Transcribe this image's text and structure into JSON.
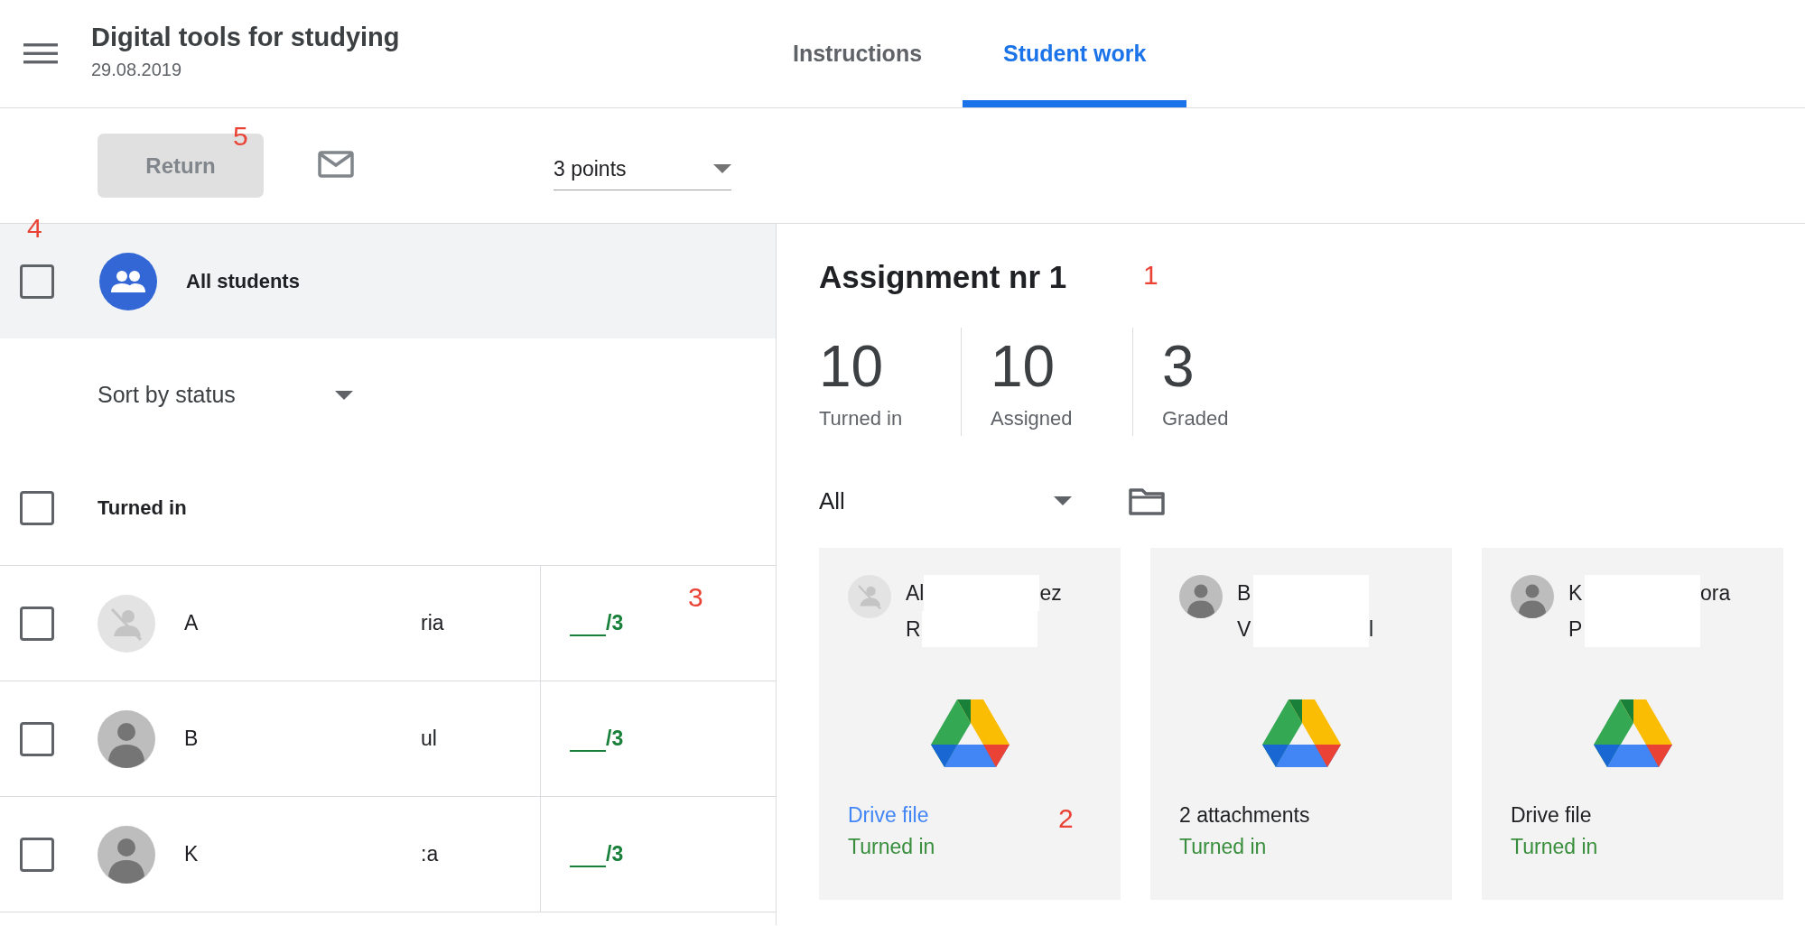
{
  "header": {
    "title": "Digital tools for studying",
    "date": "29.08.2019"
  },
  "tabs": [
    {
      "label": "Instructions",
      "selected": false
    },
    {
      "label": "Student work",
      "selected": true
    }
  ],
  "toolbar": {
    "return_button": "Return",
    "points": "3 points"
  },
  "all_students": {
    "label": "All students",
    "checked": false
  },
  "sort": {
    "label": "Sort by status"
  },
  "group_header": {
    "label": "Turned in",
    "checked": false
  },
  "students": [
    {
      "name_start": "A",
      "name_end": "ria",
      "kind": "none",
      "checked": false,
      "grade": "/3"
    },
    {
      "name_start": "B",
      "name_end": "ul",
      "kind": "person",
      "checked": false,
      "grade": "/3"
    },
    {
      "name_start": "K",
      "name_end": ":a",
      "kind": "person",
      "checked": false,
      "grade": "/3"
    }
  ],
  "assignment": {
    "title": "Assignment nr 1",
    "stats": [
      {
        "value": "10",
        "label": "Turned in"
      },
      {
        "value": "10",
        "label": "Assigned"
      },
      {
        "value": "3",
        "label": "Graded"
      }
    ],
    "filter": "All",
    "cards": [
      {
        "kind": "none",
        "name_lines": [
          {
            "start": "Al",
            "end": "ez"
          },
          {
            "start": "R"
          }
        ],
        "attachment": "Drive file",
        "attachment_link": true,
        "status": "Turned in"
      },
      {
        "kind": "person",
        "name_lines": [
          {
            "start": "B"
          },
          {
            "start": "V",
            "end": "l"
          }
        ],
        "attachment": "2 attachments",
        "attachment_link": false,
        "status": "Turned in"
      },
      {
        "kind": "person",
        "name_lines": [
          {
            "start": "K",
            "end": "ora"
          },
          {
            "start": "P"
          }
        ],
        "attachment": "Drive file",
        "attachment_link": false,
        "status": "Turned in"
      }
    ]
  },
  "annotations": [
    {
      "text": "1"
    },
    {
      "text": "2"
    },
    {
      "text": "3"
    },
    {
      "text": "4"
    },
    {
      "text": "5"
    }
  ]
}
